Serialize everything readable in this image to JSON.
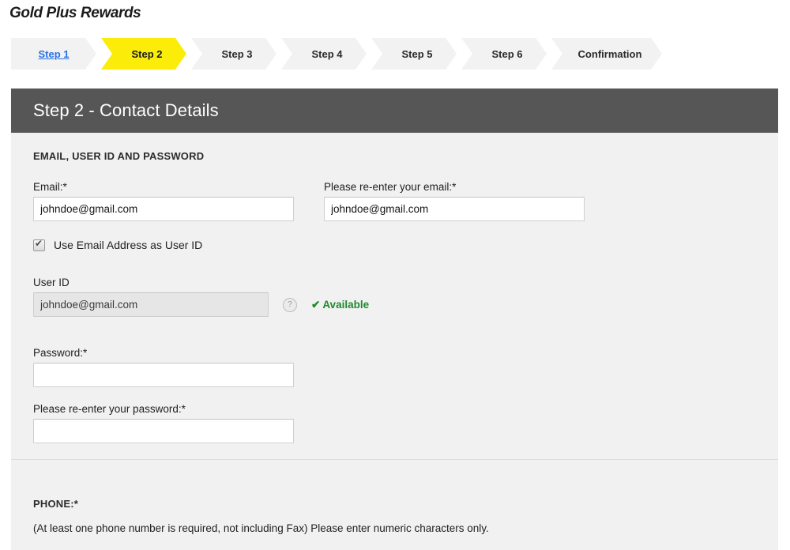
{
  "brand": {
    "title": "Gold Plus Rewards"
  },
  "stepnav": {
    "steps": [
      {
        "label": "Step 1",
        "state": "link"
      },
      {
        "label": "Step 2",
        "state": "active"
      },
      {
        "label": "Step 3",
        "state": "default"
      },
      {
        "label": "Step 4",
        "state": "default"
      },
      {
        "label": "Step 5",
        "state": "default"
      },
      {
        "label": "Step 6",
        "state": "default"
      },
      {
        "label": "Confirmation",
        "state": "default"
      }
    ],
    "active_color": "#fbed09",
    "inactive_color": "#f2f2f2",
    "link_color": "#2a72e8"
  },
  "panel": {
    "header_title": "Step 2 - Contact Details",
    "header_color": "#565656",
    "body_color": "#f1f1f1"
  },
  "email_section": {
    "title": "EMAIL, USER ID AND PASSWORD",
    "email": {
      "label": "Email:*",
      "value": "johndoe@gmail.com",
      "placeholder": ""
    },
    "email_confirm": {
      "label": "Please re-enter your email:*",
      "value": "johndoe@gmail.com",
      "placeholder": ""
    },
    "use_email_checkbox": {
      "label": "Use Email Address as User ID",
      "checked": true
    },
    "user_id": {
      "label": "User ID",
      "value": "johndoe@gmail.com",
      "placeholder": "",
      "disabled": true,
      "help_icon": "question-mark-icon",
      "status_text": "Available",
      "status_tick": "✔",
      "status_color": "#1f8a2e"
    },
    "password": {
      "label": "Password:*",
      "value": "",
      "placeholder": ""
    },
    "password_confirm": {
      "label": "Please re-enter your password:*",
      "value": "",
      "placeholder": ""
    }
  },
  "phone_section": {
    "title": "PHONE:*",
    "note": "(At least one phone number is required, not including Fax) Please enter numeric characters only."
  }
}
